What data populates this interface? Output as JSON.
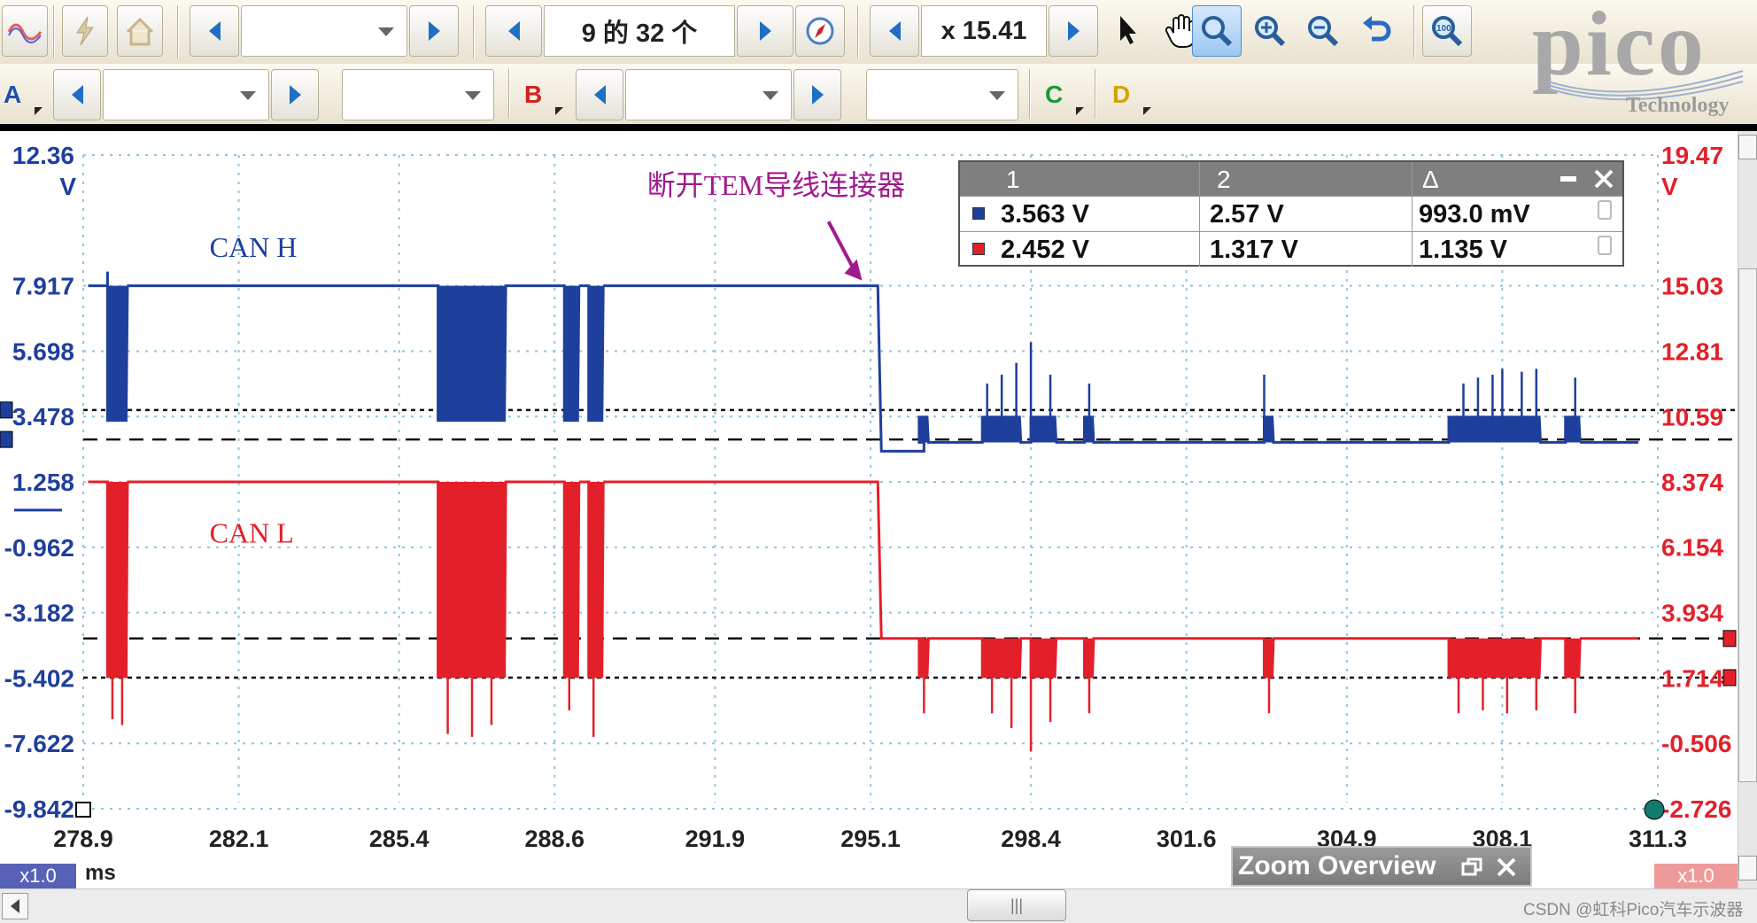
{
  "toolbar": {
    "waveform_count_value": "9 的 32 个",
    "zoom_value": "x 15.41"
  },
  "channel_bar": {
    "channels": [
      {
        "label": "A",
        "color": "#1a50b0"
      },
      {
        "label": "B",
        "color": "#d42020"
      },
      {
        "label": "C",
        "color": "#1a9a35"
      },
      {
        "label": "D",
        "color": "#d4a400"
      }
    ]
  },
  "logo": {
    "word": "pico",
    "tagline": "Technology"
  },
  "colors": {
    "channel_a": "#1f3f9c",
    "channel_b": "#e3202a",
    "grid": "#8ec6dd",
    "annotation": "#a01a8c"
  },
  "chart_data": {
    "type": "line",
    "x_axis": {
      "unit": "ms",
      "ticks": [
        "278.9",
        "282.1",
        "285.4",
        "288.6",
        "291.9",
        "295.1",
        "298.4",
        "301.6",
        "304.9",
        "308.1",
        "311.3"
      ],
      "range": [
        278.9,
        311.3
      ]
    },
    "y_axis_left": {
      "unit": "V",
      "ticks": [
        "12.36",
        "7.917",
        "5.698",
        "3.478",
        "1.258",
        "-0.962",
        "-3.182",
        "-5.402",
        "-7.622",
        "-9.842"
      ],
      "range": [
        -9.842,
        12.36
      ]
    },
    "y_axis_right": {
      "unit": "V",
      "ticks": [
        "19.47",
        "15.03",
        "12.81",
        "10.59",
        "8.374",
        "6.154",
        "3.934",
        "1.714",
        "-0.506",
        "-2.726"
      ],
      "range": [
        -2.726,
        19.47
      ]
    },
    "grid": true,
    "series": [
      {
        "name": "CAN H",
        "color": "#1f3f9c",
        "scale": "left",
        "high_level": 7.917,
        "low_level": 3.3,
        "dominant_min": 3.3,
        "x": [
          278.9,
          279.3,
          279.4,
          279.8,
          280.0,
          286.2,
          287.6,
          288.4,
          288.7,
          289.3,
          289.6,
          295.2,
          295.4,
          295.7,
          297.3,
          298.2,
          299.0,
          299.7,
          307.4,
          308.1,
          311.0
        ],
        "values": [
          7.92,
          7.92,
          3.3,
          3.3,
          7.92,
          7.92,
          3.3,
          7.92,
          7.92,
          3.3,
          7.92,
          7.92,
          2.3,
          2.6,
          2.6,
          3.6,
          2.6,
          2.6,
          2.6,
          3.6,
          2.6
        ],
        "bursts": [
          [
            279.4,
            279.8
          ],
          [
            286.2,
            287.6
          ],
          [
            288.8,
            289.1
          ],
          [
            289.3,
            289.6
          ],
          [
            296.1,
            296.3
          ],
          [
            297.4,
            298.2
          ],
          [
            298.4,
            298.9
          ],
          [
            299.5,
            299.7
          ],
          [
            303.2,
            303.4
          ],
          [
            307.0,
            308.9
          ],
          [
            309.4,
            309.7
          ]
        ],
        "spikes": [
          [
            297.5,
            4.6
          ],
          [
            297.8,
            4.9
          ],
          [
            298.1,
            5.3
          ],
          [
            298.4,
            6.0
          ],
          [
            298.8,
            4.9
          ],
          [
            299.6,
            4.6
          ],
          [
            303.2,
            4.9
          ],
          [
            307.3,
            4.6
          ],
          [
            307.6,
            4.8
          ],
          [
            307.9,
            4.9
          ],
          [
            308.1,
            5.1
          ],
          [
            308.5,
            5.0
          ],
          [
            308.8,
            5.1
          ],
          [
            309.6,
            4.8
          ]
        ]
      },
      {
        "name": "CAN L",
        "color": "#e3202a",
        "scale": "left",
        "high_level": 1.258,
        "low_level": -5.402,
        "dominant_min": -5.402,
        "bursts": [
          [
            279.4,
            279.8
          ],
          [
            286.2,
            287.6
          ],
          [
            288.8,
            289.1
          ],
          [
            289.3,
            289.6
          ],
          [
            296.1,
            296.3
          ],
          [
            297.4,
            298.2
          ],
          [
            298.4,
            298.9
          ],
          [
            299.5,
            299.7
          ],
          [
            303.2,
            303.4
          ],
          [
            307.0,
            308.9
          ],
          [
            309.4,
            309.7
          ]
        ],
        "spikes": [
          [
            279.5,
            -6.8
          ],
          [
            279.7,
            -7.0
          ],
          [
            286.4,
            -7.3
          ],
          [
            286.9,
            -7.4
          ],
          [
            287.3,
            -7.0
          ],
          [
            288.9,
            -6.5
          ],
          [
            289.4,
            -7.4
          ],
          [
            296.2,
            -6.6
          ],
          [
            297.6,
            -6.6
          ],
          [
            298.0,
            -7.1
          ],
          [
            298.4,
            -7.9
          ],
          [
            298.8,
            -6.9
          ],
          [
            299.6,
            -6.6
          ],
          [
            303.3,
            -6.6
          ],
          [
            307.2,
            -6.6
          ],
          [
            307.7,
            -6.5
          ],
          [
            308.2,
            -6.6
          ],
          [
            308.8,
            -6.5
          ],
          [
            309.6,
            -6.6
          ]
        ]
      }
    ],
    "rulers": [
      {
        "axis": "left",
        "value": 3.7,
        "style": "dotted"
      },
      {
        "axis": "left",
        "value": 2.7,
        "style": "dashed"
      },
      {
        "axis": "left",
        "value": -4.06,
        "style": "dashed"
      },
      {
        "axis": "left",
        "value": -5.39,
        "style": "dotted"
      }
    ],
    "annotations": [
      {
        "text": "CAN H",
        "x": 281.5,
        "y": 8.9,
        "color": "#1f3f9c"
      },
      {
        "text": "CAN L",
        "x": 281.5,
        "y": -0.8,
        "color": "#e3202a"
      },
      {
        "text": "断开TEM导线连接器",
        "x": 290.5,
        "y": 11.0,
        "color": "#a01a8c",
        "arrow_to": [
          295.0,
          7.917
        ]
      }
    ],
    "ruler_table": {
      "headers": [
        "1",
        "2",
        "Δ"
      ],
      "rows": [
        {
          "channel": "A",
          "values": [
            "3.563 V",
            "2.57 V",
            "993.0 mV"
          ]
        },
        {
          "channel": "B",
          "values": [
            "2.452 V",
            "1.317 V",
            "1.135 V"
          ]
        }
      ]
    },
    "scale_factors": {
      "left": "x1.0",
      "right": "x1.0"
    }
  },
  "zoom_overview": {
    "title": "Zoom Overview"
  },
  "watermark": "CSDN @虹科Pico汽车示波器"
}
